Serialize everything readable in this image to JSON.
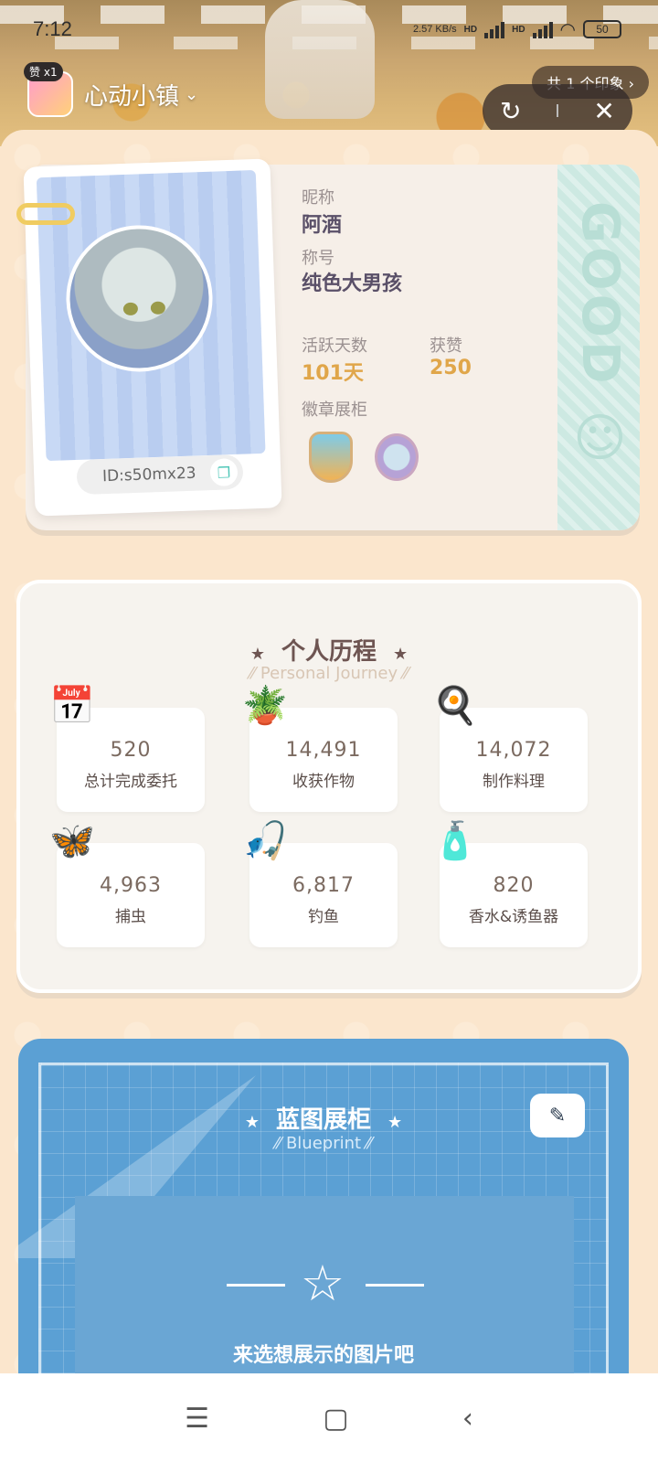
{
  "status_bar": {
    "time": "7:12",
    "net_speed": "2.57 KB/s",
    "hd1": "HD",
    "hd2": "HD",
    "battery": "50"
  },
  "miniapp": {
    "badge_icon": "赞",
    "badge_count": "x1",
    "name": "心动小镇",
    "impression_text": "共 1 个印象",
    "share_icon": "share-icon",
    "close_icon": "close-icon"
  },
  "profile": {
    "nickname_label": "昵称",
    "nickname": "阿酒",
    "title_label": "称号",
    "title": "纯色大男孩",
    "active_days_label": "活跃天数",
    "active_days": "101天",
    "likes_label": "获赞",
    "likes": "250",
    "badge_label": "徽章展柜",
    "id_text": "ID:s50mx23",
    "stripe_text": "GOOD ☺"
  },
  "journey": {
    "title": "个人历程",
    "subtitle": "Personal Journey",
    "stats": [
      {
        "value": "520",
        "label": "总计完成委托",
        "icon": "calendar-icon"
      },
      {
        "value": "14,491",
        "label": "收获作物",
        "icon": "watering-can-icon"
      },
      {
        "value": "14,072",
        "label": "制作料理",
        "icon": "stove-icon"
      },
      {
        "value": "4,963",
        "label": "捕虫",
        "icon": "bug-net-icon"
      },
      {
        "value": "6,817",
        "label": "钓鱼",
        "icon": "fishing-rod-icon"
      },
      {
        "value": "820",
        "label": "香水&诱鱼器",
        "icon": "perfume-icon"
      }
    ]
  },
  "blueprint": {
    "title": "蓝图展柜",
    "subtitle": "Blueprint",
    "empty_text": "来选想展示的图片吧"
  },
  "colors": {
    "sheet_bg": "#fbe6cd",
    "accent_gold": "#e0a64a",
    "blueprint_blue": "#5ba0d4",
    "mint": "#cde9e2"
  }
}
